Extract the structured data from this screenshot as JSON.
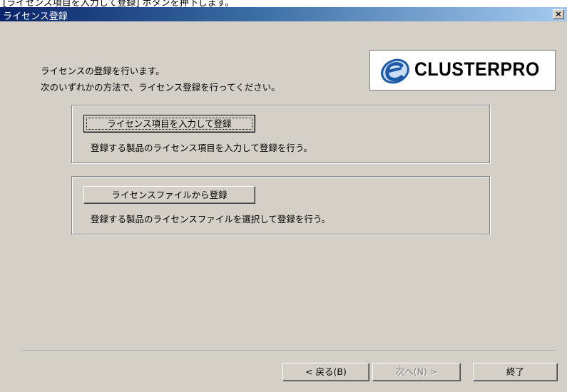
{
  "clipped_header_text": "[ライセンス項目を入力して登録] ボタンを押下します。",
  "window": {
    "title": "ライセンス登録",
    "close_glyph": "×"
  },
  "intro": {
    "line1": "ライセンスの登録を行います。",
    "line2": "次のいずれかの方法で、ライセンス登録を行ってください。"
  },
  "logo": {
    "text": "CLUSTERPRO",
    "icon": "clusterpro-e-logo-icon",
    "color": "#1e5aa8"
  },
  "options": [
    {
      "button_label": "ライセンス項目を入力して登録",
      "description": "登録する製品のライセンス項目を入力して登録を行う。",
      "focused": true
    },
    {
      "button_label": "ライセンスファイルから登録",
      "description": "登録する製品のライセンスファイルを選択して登録を行う。",
      "focused": false
    }
  ],
  "footer": {
    "back_label": "< 戻る(B)",
    "next_label": "次へ(N) >",
    "next_enabled": false,
    "exit_label": "終了"
  },
  "colors": {
    "dialog_bg": "#d4d0c8",
    "titlebar_start": "#0a246a",
    "titlebar_end": "#a6caf0"
  }
}
